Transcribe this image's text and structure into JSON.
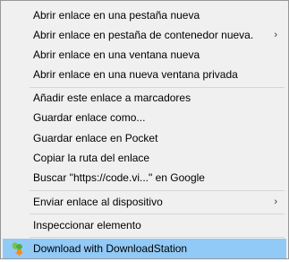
{
  "menu": {
    "items": [
      {
        "label": "Abrir enlace en una pestaña nueva"
      },
      {
        "label": "Abrir enlace en pestaña de contenedor nueva.",
        "arrow": "›"
      },
      {
        "label": "Abrir enlace en una ventana nueva"
      },
      {
        "label": "Abrir enlace en una nueva ventana privada"
      },
      {
        "label": "Añadir este enlace a marcadores"
      },
      {
        "label": "Guardar enlace como..."
      },
      {
        "label": "Guardar enlace en Pocket"
      },
      {
        "label": "Copiar la ruta del enlace"
      },
      {
        "label": "Buscar \"https://code.vi...\" en Google"
      },
      {
        "label": "Enviar enlace al dispositivo",
        "arrow": "›"
      },
      {
        "label": "Inspeccionar elemento"
      },
      {
        "label": "Download with DownloadStation",
        "icon": "downloadstation-icon"
      }
    ]
  },
  "colors": {
    "menu_background": "#f0f0f0",
    "highlight": "#91c9f7",
    "separator": "#d7d7d7",
    "border": "#979797"
  }
}
